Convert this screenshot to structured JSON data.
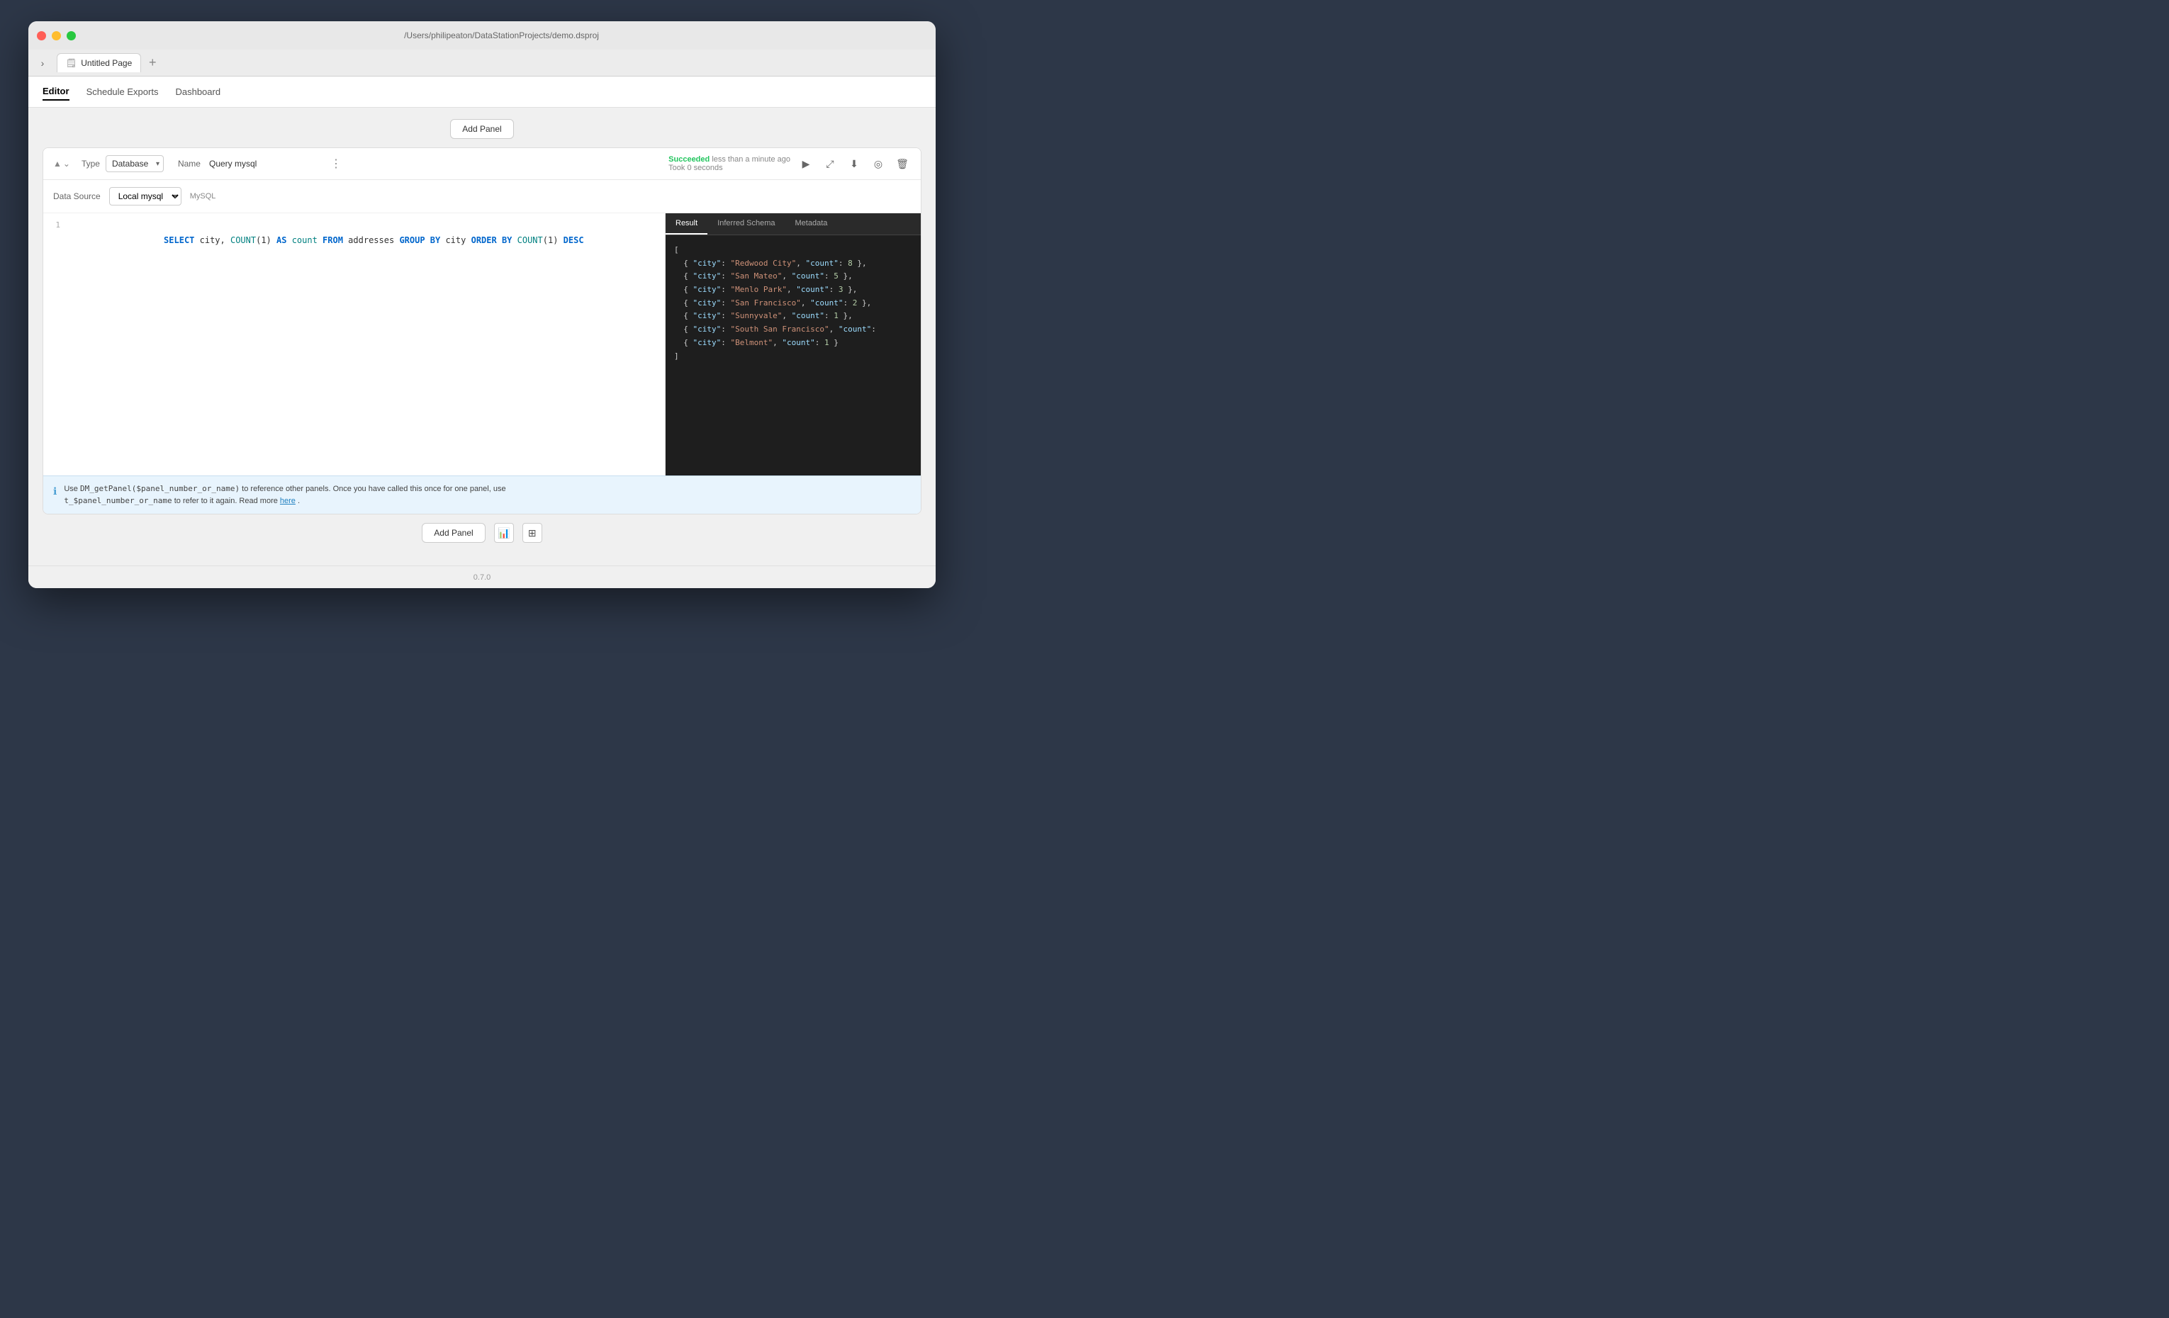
{
  "titlebar": {
    "title": "/Users/philipeaton/DataStationProjects/demo.dsproj"
  },
  "tab": {
    "icon": "🗒",
    "label": "Untitled Page"
  },
  "nav": {
    "items": [
      "Editor",
      "Schedule Exports",
      "Dashboard"
    ],
    "active": "Editor"
  },
  "add_panel": {
    "label": "Add Panel"
  },
  "panel": {
    "type_label": "Type",
    "type_value": "Database",
    "name_label": "Name",
    "name_value": "Query mysql",
    "status": {
      "succeeded": "Succeeded",
      "detail": "less than a minute ago",
      "took": "Took 0 seconds"
    },
    "datasource": {
      "label": "Data Source",
      "value": "Local mysql",
      "type": "MySQL"
    },
    "code": "SELECT city, COUNT(1) AS count FROM addresses GROUP BY city ORDER BY COUNT(1) DESC",
    "info_text": "Use DM_getPanel($panel_number_or_name) to reference other panels. Once you have called this once for one panel, use\nt_$panel_number_or_name to refer to it again. Read more",
    "info_link": "here",
    "result_tabs": [
      "Result",
      "Inferred Schema",
      "Metadata"
    ],
    "active_result_tab": "Result",
    "result_data": [
      {
        "city": "Redwood City",
        "count": 8
      },
      {
        "city": "San Mateo",
        "count": 5
      },
      {
        "city": "Menlo Park",
        "count": 3
      },
      {
        "city": "San Francisco",
        "count": 2
      },
      {
        "city": "Sunnyvale",
        "count": 1
      },
      {
        "city": "South San Francisco",
        "count": "..."
      },
      {
        "city": "Belmont",
        "count": 1
      }
    ]
  },
  "footer": {
    "version": "0.7.0"
  },
  "icons": {
    "play": "▶",
    "expand": "⤢",
    "download": "⬇",
    "eye_off": "◎",
    "trash": "🗑",
    "info": "ℹ",
    "bars": "📊",
    "table": "⊞",
    "chevron_right": "›",
    "chevron_down": "⌄",
    "collapse": "▲",
    "sidebar": "›"
  }
}
